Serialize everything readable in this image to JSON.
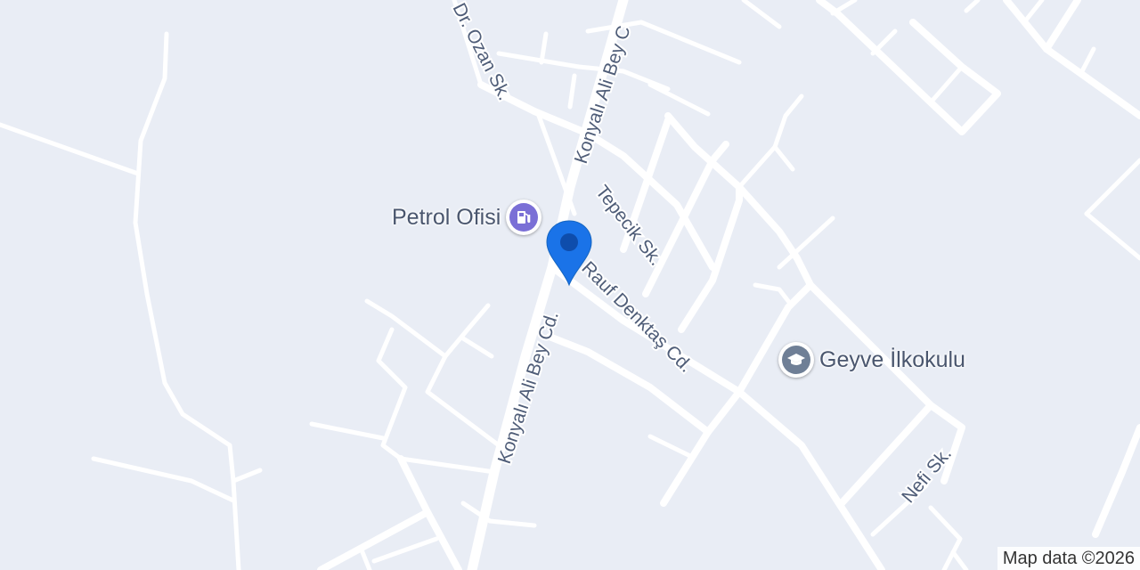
{
  "map": {
    "streets": {
      "dr_ozan": "Dr. Ozan Sk.",
      "konyali_top": "Konyalı Ali Bey C",
      "konyali_mid": "Konyalı Ali Bey Cd.",
      "konyali_bottom": "Konyalı Ali Bey Cd.",
      "tepecik": "Tepecik Sk.",
      "rauf": "Rauf Denktaş Cd.",
      "nefi": "Nefi Sk."
    },
    "pois": {
      "petrol": {
        "label": "Petrol Ofisi",
        "icon": "gas-station-icon",
        "color": "#7a6fd6"
      },
      "school": {
        "label": "Geyve İlkokulu",
        "icon": "school-icon",
        "color": "#6f7f96"
      }
    },
    "marker": {
      "icon": "location-pin-icon",
      "color": "#1a73e8"
    },
    "attribution": "Map data ©2026",
    "colors": {
      "background": "#e9edf5",
      "road": "#ffffff",
      "label": "#4f5d78"
    }
  }
}
